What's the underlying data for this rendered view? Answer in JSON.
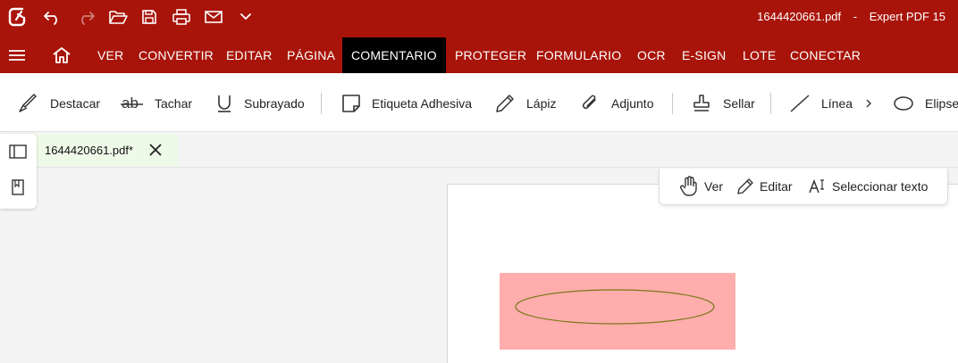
{
  "titlebar": {
    "filename": "1644420661.pdf",
    "separator": "-",
    "app_name": "Expert PDF 15"
  },
  "menu": {
    "items": [
      {
        "label": "VER"
      },
      {
        "label": "CONVERTIR"
      },
      {
        "label": "EDITAR"
      },
      {
        "label": "PÁGINA"
      },
      {
        "label": "COMENTARIO"
      },
      {
        "label": "PROTEGER"
      },
      {
        "label": "FORMULARIO"
      },
      {
        "label": "OCR"
      },
      {
        "label": "E-SIGN"
      },
      {
        "label": "LOTE"
      },
      {
        "label": "CONECTAR"
      }
    ],
    "active": "COMENTARIO"
  },
  "ribbon": {
    "items": [
      {
        "label": "Destacar",
        "icon": "highlighter-icon"
      },
      {
        "label": "Tachar",
        "icon": "strikethrough-icon"
      },
      {
        "label": "Subrayado",
        "icon": "underline-icon"
      },
      {
        "label": "Etiqueta Adhesiva",
        "icon": "sticky-note-icon"
      },
      {
        "label": "Lápiz",
        "icon": "pencil-icon"
      },
      {
        "label": "Adjunto",
        "icon": "paperclip-icon"
      },
      {
        "label": "Sellar",
        "icon": "stamp-icon"
      },
      {
        "label": "Línea",
        "icon": "line-icon"
      },
      {
        "label": "Elipse",
        "icon": "ellipse-icon"
      }
    ]
  },
  "tabs": {
    "document": "1644420661.pdf*"
  },
  "modebar": {
    "view": "Ver",
    "edit": "Editar",
    "select_text": "Seleccionar texto"
  },
  "colors": {
    "brand": "#a8140a",
    "active_menu": "#000000",
    "annotation_fill": "#ffadad",
    "annotation_stroke": "#7a7a1a",
    "tab_bg": "#eefae8"
  }
}
